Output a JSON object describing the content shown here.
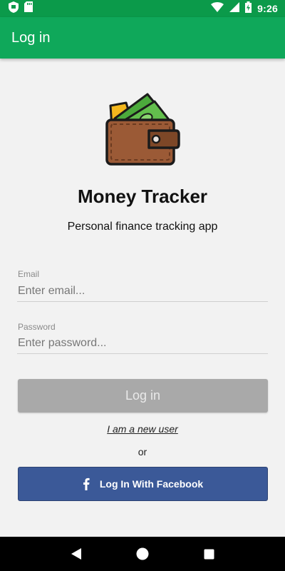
{
  "status_bar": {
    "time": "9:26",
    "icons": [
      "shield-icon",
      "sd-card-icon",
      "wifi-icon",
      "signal-icon",
      "battery-charging-icon"
    ]
  },
  "app_bar": {
    "title": "Log in"
  },
  "header": {
    "logo_icon": "wallet-icon",
    "title": "Money Tracker",
    "subtitle": "Personal finance tracking app"
  },
  "form": {
    "email": {
      "label": "Email",
      "value": "",
      "placeholder": "Enter email..."
    },
    "password": {
      "label": "Password",
      "value": "",
      "placeholder": "Enter password..."
    },
    "login_label": "Log in",
    "new_user_label": "I am a new user",
    "or_label": "or",
    "facebook_label": "Log In With Facebook"
  },
  "nav_bar": {
    "icons": [
      "back-icon",
      "home-icon",
      "recents-icon"
    ]
  },
  "colors": {
    "status_bar": "#0b9a4a",
    "app_bar": "#0fa85a",
    "background": "#f2f2f2",
    "login_disabled": "#a9a9a9",
    "facebook": "#3b5998"
  }
}
